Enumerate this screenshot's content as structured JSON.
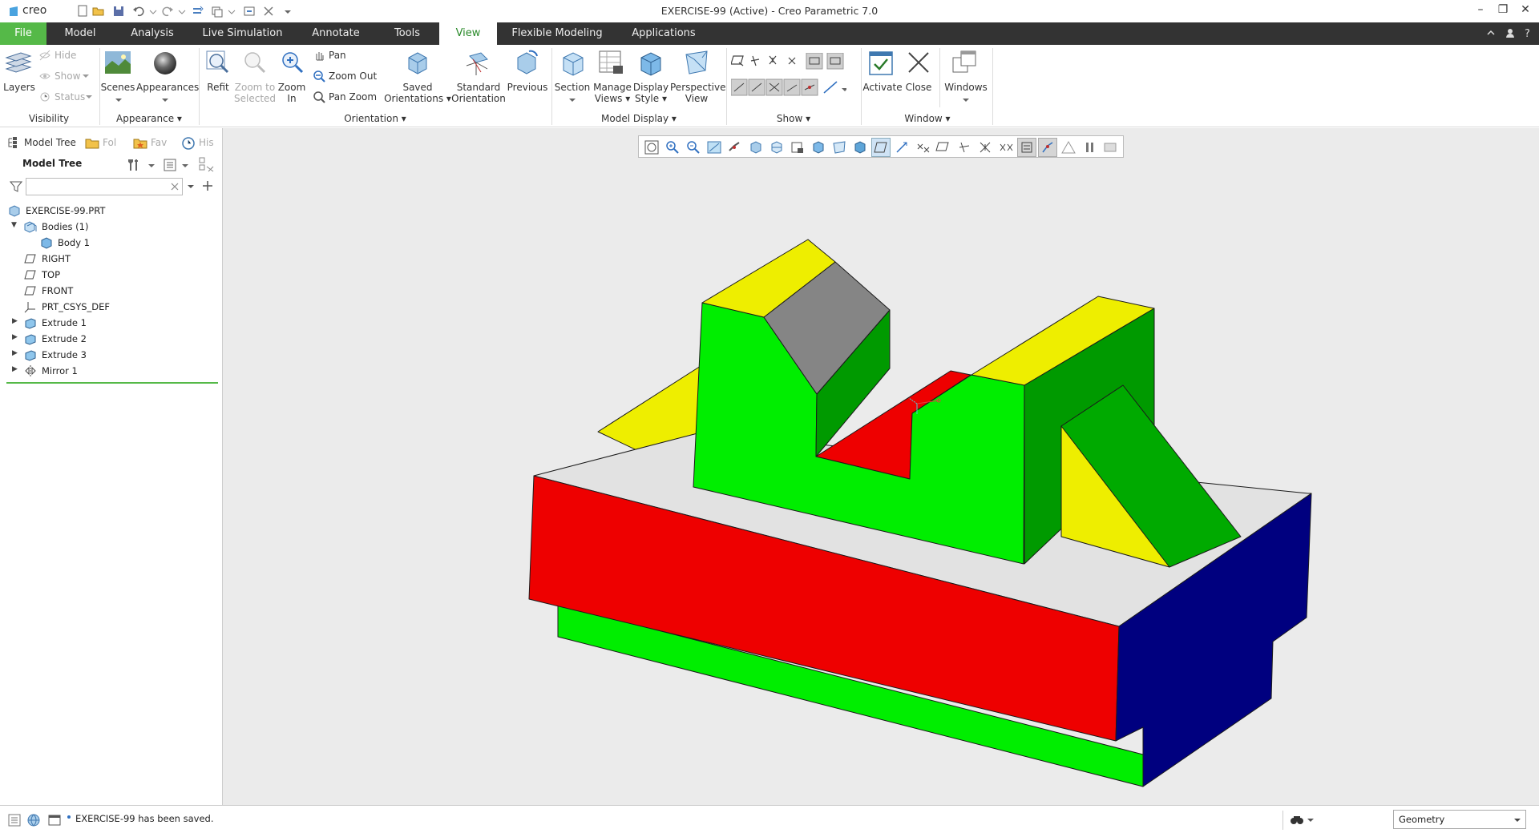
{
  "app": {
    "logo": "creo",
    "window_title": "EXERCISE-99 (Active) - Creo Parametric 7.0"
  },
  "tabs": [
    {
      "label": "File"
    },
    {
      "label": "Model"
    },
    {
      "label": "Analysis"
    },
    {
      "label": "Live Simulation"
    },
    {
      "label": "Annotate"
    },
    {
      "label": "Tools"
    },
    {
      "label": "View",
      "active": true
    },
    {
      "label": "Flexible Modeling"
    },
    {
      "label": "Applications"
    }
  ],
  "ribbon": {
    "visibility": {
      "layers": "Layers",
      "hide": "Hide",
      "show": "Show",
      "status": "Status",
      "group": "Visibility"
    },
    "appearance": {
      "scenes": "Scenes",
      "appearances": "Appearances",
      "group": "Appearance"
    },
    "orientation": {
      "refit": "Refit",
      "zoom_to_selected_1": "Zoom to",
      "zoom_to_selected_2": "Selected",
      "zoom_in_1": "Zoom",
      "zoom_in_2": "In",
      "pan": "Pan",
      "zoom_out": "Zoom Out",
      "pan_zoom": "Pan Zoom",
      "saved_1": "Saved",
      "saved_2": "Orientations",
      "standard_1": "Standard",
      "standard_2": "Orientation",
      "previous": "Previous",
      "group": "Orientation"
    },
    "model_display": {
      "section": "Section",
      "manage_1": "Manage",
      "manage_2": "Views",
      "display_1": "Display",
      "display_2": "Style",
      "perspective_1": "Perspective",
      "perspective_2": "View",
      "group": "Model Display"
    },
    "show": {
      "group": "Show"
    },
    "window": {
      "activate": "Activate",
      "close": "Close",
      "windows": "Windows",
      "group": "Window"
    }
  },
  "left_panel": {
    "tabs": [
      "Model Tree",
      "Fol",
      "Fav",
      "His"
    ],
    "header": "Model Tree",
    "search_value": "",
    "tree": [
      {
        "label": "EXERCISE-99.PRT",
        "icon": "part-icon"
      },
      {
        "label": "Bodies (1)",
        "icon": "bodies-icon",
        "expanded": true
      },
      {
        "label": "Body 1",
        "icon": "body-icon"
      },
      {
        "label": "RIGHT",
        "icon": "datum-plane-icon"
      },
      {
        "label": "TOP",
        "icon": "datum-plane-icon"
      },
      {
        "label": "FRONT",
        "icon": "datum-plane-icon"
      },
      {
        "label": "PRT_CSYS_DEF",
        "icon": "csys-icon"
      },
      {
        "label": "Extrude 1",
        "icon": "extrude-icon"
      },
      {
        "label": "Extrude 2",
        "icon": "extrude-icon"
      },
      {
        "label": "Extrude 3",
        "icon": "extrude-icon"
      },
      {
        "label": "Mirror 1",
        "icon": "mirror-icon"
      }
    ]
  },
  "status_bar": {
    "message": "EXERCISE-99 has been saved.",
    "filter": "Geometry"
  },
  "colors": {
    "face_green": "#00ee00",
    "face_dark_green": "#009a00",
    "face_red": "#ee0000",
    "face_yellow": "#eeee00",
    "face_gray": "#858585",
    "face_navy": "#00007f",
    "face_light": "#e2e2e2",
    "viewport_bg": "#ebebeb",
    "accent": "#55b948"
  }
}
